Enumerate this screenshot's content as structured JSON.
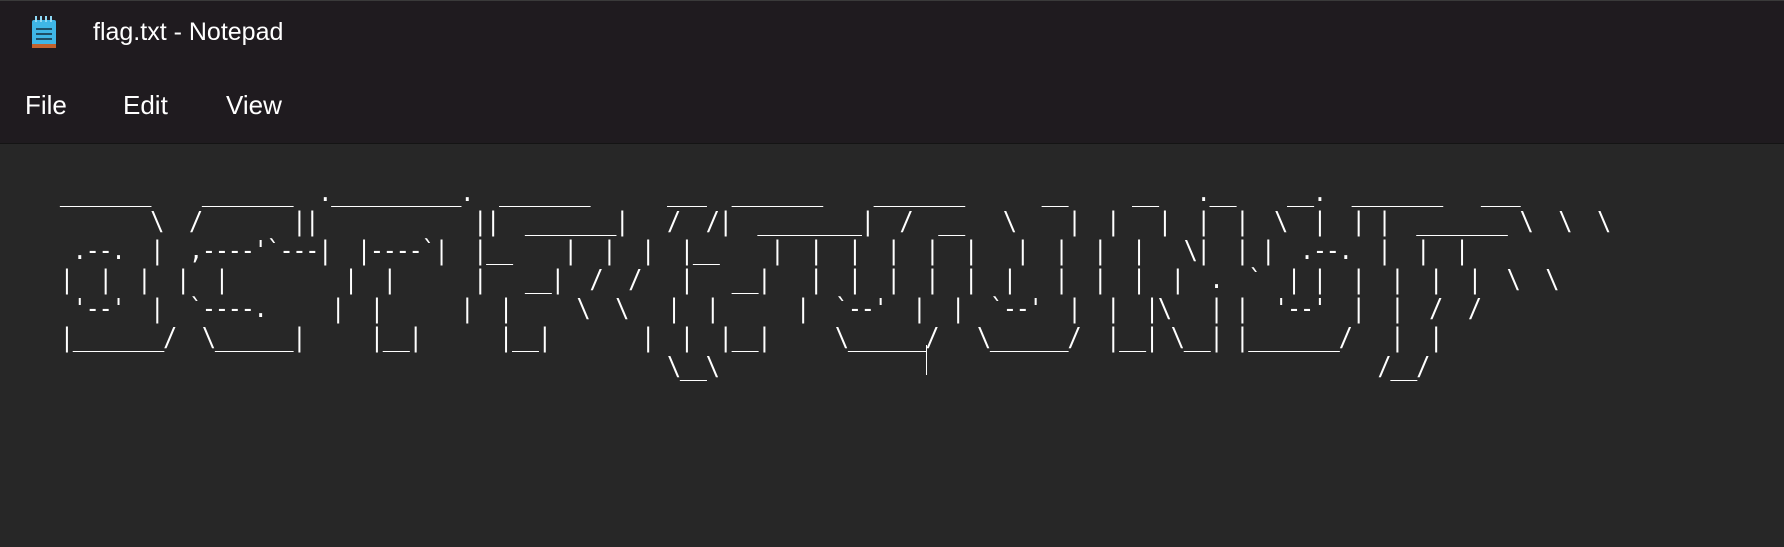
{
  "window": {
    "title": "flag.txt - Notepad"
  },
  "icons": {
    "app_icon": "notepad-icon"
  },
  "colors": {
    "titlebar_bg": "#1f1b1f",
    "editor_bg": "#272727",
    "text": "#ffffff",
    "icon_accent": "#3fb6e6"
  },
  "menu": {
    "file": "File",
    "edit": "Edit",
    "view": "View"
  },
  "editor": {
    "content": "  _______    _______  .__________.  _______      ___  _______    _______      __     __   .__    __.  _______   ___\n         \\  /       ||            ||  _______|   /  /|  ________|  /  __   \\    |  |   |  |  |  \\  |  | |  _______ \\  \\  \\\n   .--.  |  ,----'`---|  |----`|  |__    |  |  |  |__    |  |  |  |  |  |   |  |  |  |   \\|  | |  .--.  |  |  |\n  |  |  |  |  |         |  |      |   __|  /  /   |   __|   |  |  |  |  |  |   |  |  |  |  .  `  | |  |  |  |  |  \\  \\\n   '--'  |  `----.     |  |      |  |     \\  \\   |  |      |  `--'  |  |  `--'  |  |  |\\   | |  '--'  |  |  /  /\n  |_______/  \\______|     |__|      |__|       |  |  |__|     \\______/   \\______/  |__| \\__| |_______/   |  |\n                                                 \\__\\                                                   /__/"
  }
}
